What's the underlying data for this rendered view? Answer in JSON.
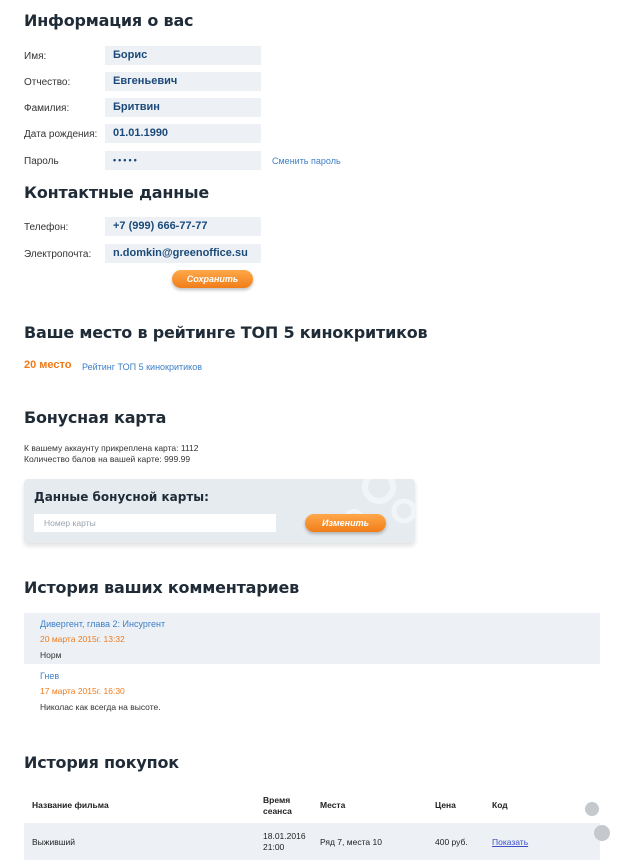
{
  "personal": {
    "title": "Информация о вас",
    "fields": [
      {
        "label": "Имя:",
        "value": "Борис"
      },
      {
        "label": "Отчество:",
        "value": "Евгеньевич"
      },
      {
        "label": "Фамилия:",
        "value": "Бритвин"
      },
      {
        "label": "Дата рождения:",
        "value": "01.01.1990"
      },
      {
        "label": "Пароль",
        "value": "•••••"
      }
    ],
    "change_password": "Сменить пароль"
  },
  "contacts": {
    "title": "Контактные данные",
    "phone_label": "Телефон:",
    "phone": "+7 (999) 666-77-77",
    "email_label": "Электропочта:",
    "email": "n.domkin@greenoffice.su",
    "save": "Сохранить"
  },
  "rating": {
    "title": "Ваше место в рейтинге ТОП 5 кинокритиков",
    "place": "20 место",
    "link": "Рейтинг ТОП 5 кинокритиков"
  },
  "bonus": {
    "title": "Бонусная карта",
    "line1": "К вашему аккаунту прикреплена карта: 1112",
    "line2": "Количество балов на вашей карте: 999.99",
    "box_title": "Данные бонусной карты:",
    "placeholder": "Номер карты",
    "change": "Изменить"
  },
  "comments": {
    "title": "История ваших комментариев",
    "items": [
      {
        "film": "Дивергент, глава 2: Инсургент",
        "date": "20 марта 2015г. 13:32",
        "text": "Норм"
      },
      {
        "film": "Гнев",
        "date": "17 марта 2015г. 16:30",
        "text": "Николас как всегда на высоте."
      }
    ]
  },
  "purchases": {
    "title": "История покупок",
    "headers": {
      "film": "Название фильма",
      "time1": "Время",
      "time2": "сеанса",
      "seats": "Места",
      "price": "Цена",
      "code": "Код"
    },
    "rows": [
      {
        "film": "Выживший",
        "date": "18.01.2016",
        "time": "21:00",
        "seats": "Ряд 7, места 10",
        "price": "400 руб.",
        "code": "Показать"
      }
    ]
  }
}
